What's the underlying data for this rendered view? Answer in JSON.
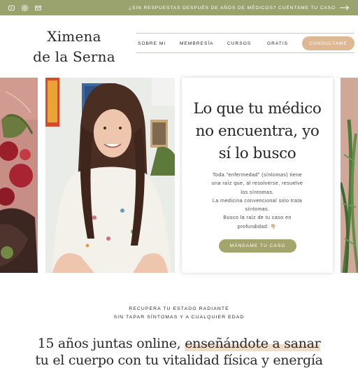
{
  "topbar": {
    "promo_text": "¿SIN RESPUESTAS DESPUÉS DE AÑOS DE MÉDICOS? CUÉNTAME TU CASO",
    "social_icons": [
      "youtube-icon",
      "instagram-icon",
      "email-icon"
    ],
    "color": "#9aa36e"
  },
  "header": {
    "logo_line1": "Ximena",
    "logo_line2": "de la Serna",
    "nav": [
      "SOBRE MI",
      "MEMBRESÍA",
      "CURSOS",
      "GRATIS"
    ],
    "consult_label": "CONSULTAME",
    "consult_color": "#deb895"
  },
  "hero": {
    "title_line1": "Lo que tu médico",
    "title_line2": "no encuentra, yo",
    "title_line3": "sí lo busco",
    "body": [
      "Toda \"enfermedad\" (síntomas) tiene",
      "una raíz que, al resolverse, resuelve",
      "los síntomas.",
      "La medicina convencional solo trata",
      "síntomas.",
      "Busco la raíz de tu caso en",
      "profundidad: 👇🏼"
    ],
    "cta_label": "MÁNDAME TU CASO",
    "cta_color": "#a3a56d"
  },
  "section": {
    "sub_line1": "RECUPERA TU ESTADO RADIANTE",
    "sub_line2": "SIN TAPAR SÍNTOMAS Y A CUALQUIER EDAD",
    "headline_part1": "15 años juntas online, ",
    "headline_part2": "enseñándote a sanar",
    "headline_line2": "tu el cuerpo con tu vitalidad física y energía"
  }
}
